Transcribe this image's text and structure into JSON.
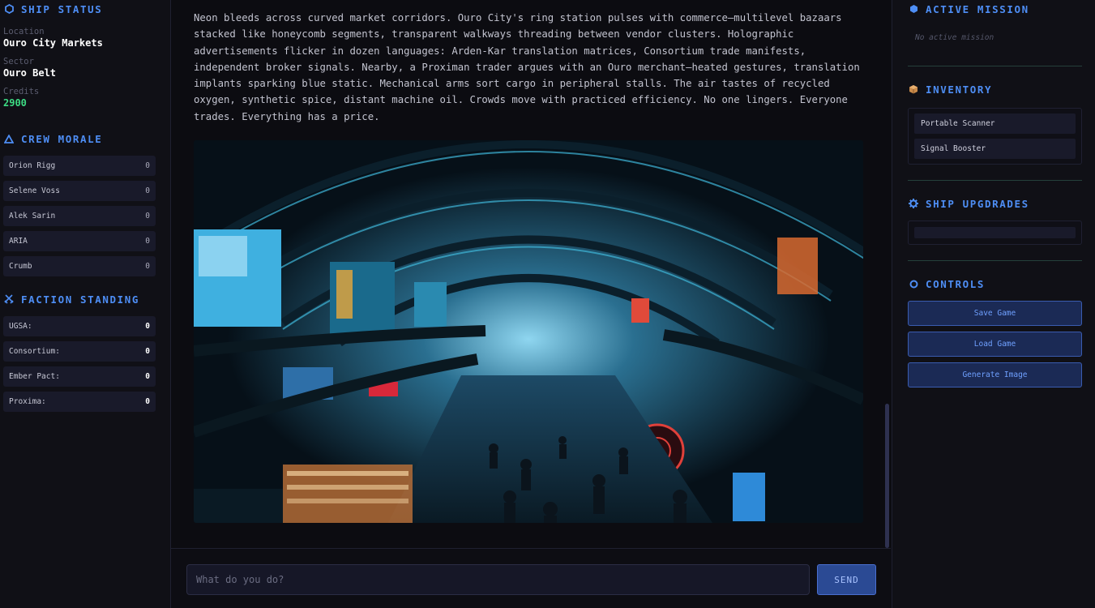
{
  "ship_status": {
    "title": "SHIP STATUS",
    "location_label": "Location",
    "location": "Ouro City Markets",
    "sector_label": "Sector",
    "sector": "Ouro Belt",
    "credits_label": "Credits",
    "credits": "2900"
  },
  "crew_morale": {
    "title": "CREW MORALE",
    "members": [
      {
        "name": "Orion Rigg",
        "value": "0"
      },
      {
        "name": "Selene Voss",
        "value": "0"
      },
      {
        "name": "Alek Sarin",
        "value": "0"
      },
      {
        "name": "ARIA",
        "value": "0"
      },
      {
        "name": "Crumb",
        "value": "0"
      }
    ]
  },
  "faction_standing": {
    "title": "FACTION STANDING",
    "factions": [
      {
        "name": "UGSA:",
        "value": "0"
      },
      {
        "name": "Consortium:",
        "value": "0"
      },
      {
        "name": "Ember Pact:",
        "value": "0"
      },
      {
        "name": "Proxima:",
        "value": "0"
      }
    ]
  },
  "narrative": "Neon bleeds across curved market corridors. Ouro City's ring station pulses with commerce—multilevel bazaars stacked like honeycomb segments, transparent walkways threading between vendor clusters. Holographic advertisements flicker in dozen languages: Arden-Kar translation matrices, Consortium trade manifests, independent broker signals. Nearby, a Proximan trader argues with an Ouro merchant—heated gestures, translation implants sparking blue static. Mechanical arms sort cargo in peripheral stalls. The air tastes of recycled oxygen, synthetic spice, distant machine oil. Crowds move with practiced efficiency. No one lingers. Everyone trades. Everything has a price.",
  "command": {
    "placeholder": "What do you do?",
    "value": "",
    "send_label": "SEND"
  },
  "active_mission": {
    "title": "ACTIVE MISSION",
    "empty_text": "No active mission"
  },
  "inventory": {
    "title": "INVENTORY",
    "items": [
      "Portable Scanner",
      "Signal Booster"
    ]
  },
  "ship_upgrades": {
    "title": "SHIP UPGDRADES"
  },
  "controls": {
    "title": "CONTROLS",
    "save_label": "Save Game",
    "load_label": "Load Game",
    "generate_label": "Generate Image"
  },
  "colors": {
    "accent": "#4e8ef5",
    "credits": "#3ddc84",
    "background": "#0c0c11",
    "panel": "#191a2a"
  },
  "icons": {
    "ship_status": "hexagon-outline-icon",
    "crew_morale": "triangle-outline-icon",
    "faction_standing": "crossed-swords-icon",
    "active_mission": "hexagon-filled-icon",
    "inventory": "package-icon",
    "ship_upgrades": "gear-icon",
    "controls": "circle-outline-icon"
  }
}
